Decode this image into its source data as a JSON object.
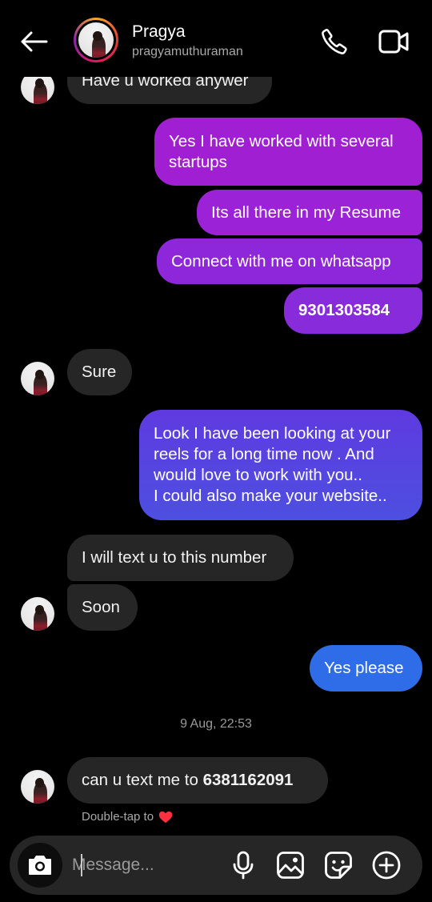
{
  "header": {
    "name": "Pragya",
    "username": "pragyamuthuraman"
  },
  "messages": [
    {
      "from": "them",
      "text": "Have u worked anywer"
    },
    {
      "from": "me",
      "text": "Yes I have worked with several\nstartups"
    },
    {
      "from": "me",
      "text": "Its all there in my Resume"
    },
    {
      "from": "me",
      "text": "Connect with me on whatsapp"
    },
    {
      "from": "me",
      "text": "9301303584"
    },
    {
      "from": "them",
      "text": "Sure"
    },
    {
      "from": "me",
      "text": "Look I have been looking at your\nreels for a long time now . And\nwould love to work with you..\nI could also make your website.."
    },
    {
      "from": "them",
      "text": "I will text u to this number"
    },
    {
      "from": "them",
      "text": "Soon"
    },
    {
      "from": "me",
      "text": "Yes please"
    },
    {
      "from": "them",
      "text_prefix": "can u text me to ",
      "text_number": "6381162091"
    }
  ],
  "timestamp": "9 Aug, 22:53",
  "reaction_hint": "Double-tap to",
  "composer": {
    "placeholder": "Message..."
  },
  "icons": {
    "back": "back-arrow-icon",
    "call": "phone-icon",
    "video": "video-camera-icon",
    "camera": "camera-icon",
    "mic": "microphone-icon",
    "gallery": "image-icon",
    "sticker": "sticker-icon",
    "plus": "plus-circle-icon",
    "heart": "heart-icon"
  },
  "colors": {
    "background": "#000000",
    "incoming_bubble": "#262626",
    "outgoing_top": "#a020d0",
    "outgoing_mid": "#6a2de0",
    "outgoing_bottom": "#2a6ee8",
    "heart": "#ff3040"
  }
}
